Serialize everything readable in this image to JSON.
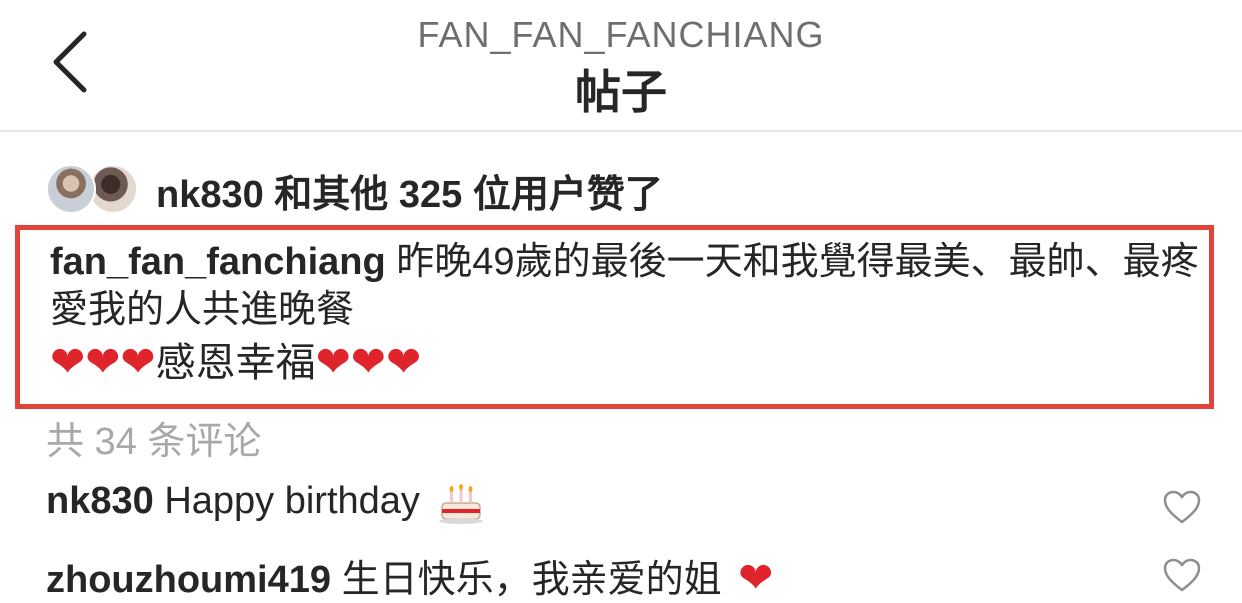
{
  "header": {
    "username": "FAN_FAN_FANCHIANG",
    "title": "帖子",
    "back_icon": "chevron-left-icon"
  },
  "likes": {
    "text": "nk830 和其他 325 位用户赞了"
  },
  "caption": {
    "username": "fan_fan_fanchiang",
    "text": "昨晚49歲的最後一天和我覺得最美、最帥、最疼愛我的人共進晚餐",
    "hearts_before": "❤❤❤",
    "line2_text": "感恩幸福",
    "hearts_after": "❤❤❤",
    "highlight_color": "#e0443a"
  },
  "comments_count": "共 34 条评论",
  "comments": [
    {
      "username": "nk830",
      "text": "Happy birthday",
      "emoji": "birthday-cake-icon"
    },
    {
      "username": "zhouzhoumi419",
      "text": "生日快乐，我亲爱的姐",
      "emoji": "❤"
    }
  ],
  "colors": {
    "text": "#262626",
    "muted": "#a8a8a8",
    "heart": "#e0242b"
  }
}
